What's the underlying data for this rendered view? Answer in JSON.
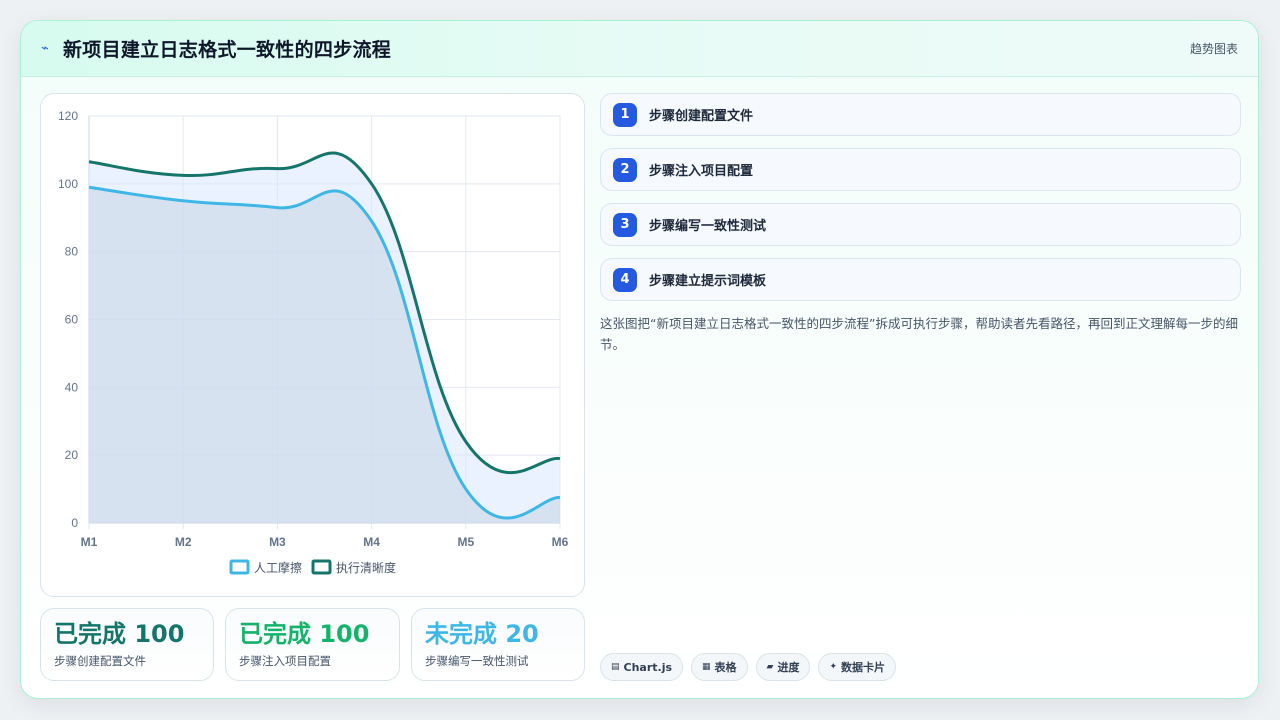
{
  "header": {
    "icon": "pulse-icon",
    "title": "新项目建立日志格式一致性的四步流程",
    "tag": "趋势图表"
  },
  "chart_data": {
    "type": "line",
    "categories": [
      "M1",
      "M2",
      "M3",
      "M4",
      "M5",
      "M6"
    ],
    "yticks": [
      0,
      20,
      40,
      60,
      80,
      100,
      120
    ],
    "ylim": [
      0,
      120
    ],
    "grid": true,
    "legend_position": "bottom",
    "series": [
      {
        "name": "人工摩擦",
        "values": [
          99,
          95,
          93,
          89,
          10,
          7.5
        ],
        "color": "#3fb7e6",
        "fill": true
      },
      {
        "name": "执行清晰度",
        "values": [
          106.5,
          102.5,
          104.5,
          100,
          24,
          19
        ],
        "color": "#16756b",
        "fill": false
      }
    ]
  },
  "stats": [
    {
      "value": "已完成 100",
      "label": "步骤创建配置文件",
      "color": "#16756b"
    },
    {
      "value": "已完成 100",
      "label": "步骤注入项目配置",
      "color": "#17b26a"
    },
    {
      "value": "未完成 20",
      "label": "步骤编写一致性测试",
      "color": "#3fb7e6"
    }
  ],
  "steps": [
    {
      "num": "1",
      "label": "步骤创建配置文件"
    },
    {
      "num": "2",
      "label": "步骤注入项目配置"
    },
    {
      "num": "3",
      "label": "步骤编写一致性测试"
    },
    {
      "num": "4",
      "label": "步骤建立提示词模板"
    }
  ],
  "description": "这张图把“新项目建立日志格式一致性的四步流程”拆成可执行步骤，帮助读者先看路径，再回到正文理解每一步的细节。",
  "chips": [
    {
      "icon": "chart-icon",
      "glyph": "▤",
      "label": "Chart.js"
    },
    {
      "icon": "table-icon",
      "glyph": "▦",
      "label": "表格"
    },
    {
      "icon": "progress-icon",
      "glyph": "▰",
      "label": "进度"
    },
    {
      "icon": "sparkle-icon",
      "glyph": "✦",
      "label": "数据卡片"
    }
  ]
}
